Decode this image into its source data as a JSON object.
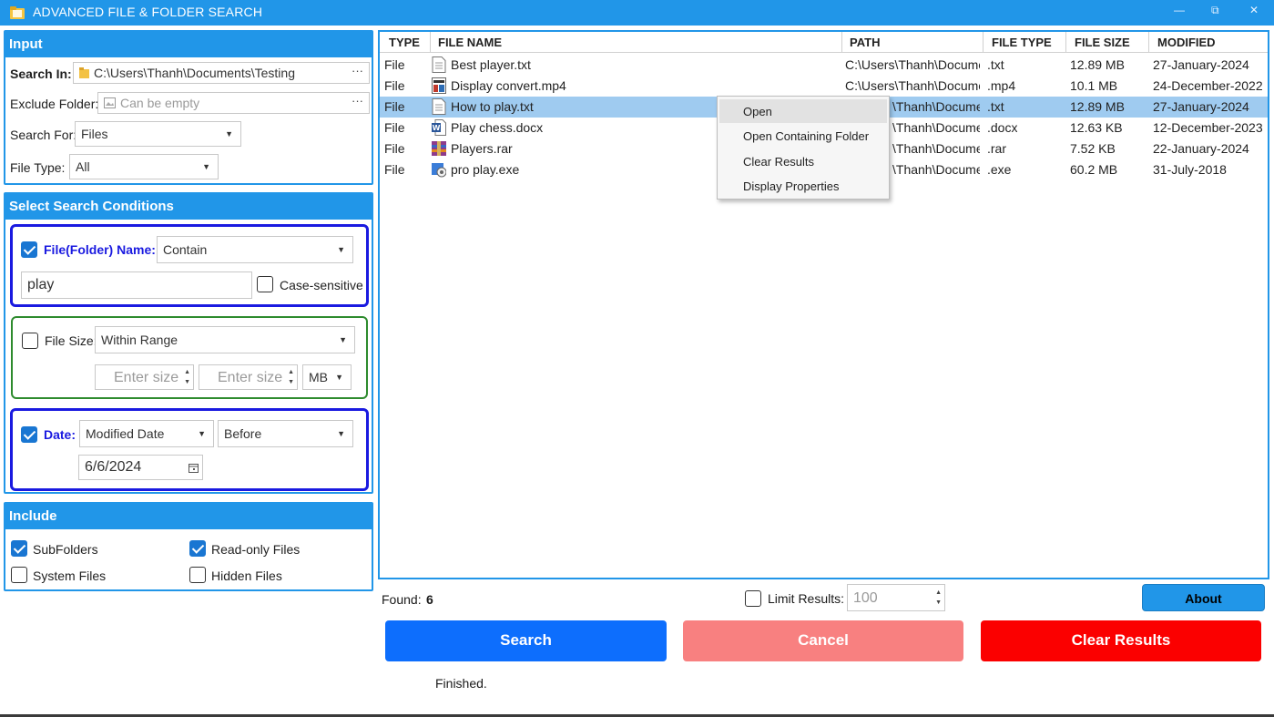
{
  "window": {
    "title": "ADVANCED FILE & FOLDER SEARCH",
    "minimize_glyph": "—",
    "restore_glyph": "⧉",
    "close_glyph": "✕",
    "icon": "folder-app-icon"
  },
  "input_panel": {
    "header": "Input",
    "search_in_label": "Search In:",
    "search_in_value": "C:\\Users\\Thanh\\Documents\\Testing",
    "browse_dots": "···",
    "exclude_label": "Exclude Folder:",
    "exclude_placeholder": "Can be empty",
    "search_for_label": "Search For:",
    "search_for_value": "Files",
    "file_type_label": "File Type:",
    "file_type_value": "All"
  },
  "conditions": {
    "header": "Select Search Conditions",
    "name": {
      "checked": true,
      "label": "File(Folder) Name:",
      "mode": "Contain",
      "query": "play",
      "case_label": "Case-sensitive",
      "case_checked": false
    },
    "size": {
      "checked": false,
      "label": "File Size:",
      "mode": "Within Range",
      "min_placeholder": "Enter size",
      "max_placeholder": "Enter size",
      "unit": "MB"
    },
    "date": {
      "checked": true,
      "label": "Date:",
      "field": "Modified Date",
      "mode": "Before",
      "value": "6/6/2024"
    }
  },
  "include": {
    "header": "Include",
    "subfolders": {
      "label": "SubFolders",
      "checked": true
    },
    "readonly": {
      "label": "Read-only Files",
      "checked": true
    },
    "system": {
      "label": "System Files",
      "checked": false
    },
    "hidden": {
      "label": "Hidden Files",
      "checked": false
    }
  },
  "results": {
    "columns": [
      "TYPE",
      "FILE NAME",
      "PATH",
      "FILE TYPE",
      "FILE SIZE",
      "MODIFIED"
    ],
    "rows": [
      {
        "type": "File",
        "name": "Best player.txt",
        "path": "C:\\Users\\Thanh\\Docume",
        "ftype": ".txt",
        "size": "12.89 MB",
        "modified": "27-January-2024",
        "icon": "text-file-icon"
      },
      {
        "type": "File",
        "name": "Display convert.mp4",
        "path": "C:\\Users\\Thanh\\Docume",
        "ftype": ".mp4",
        "size": "10.1 MB",
        "modified": "24-December-2022",
        "icon": "video-file-icon"
      },
      {
        "type": "File",
        "name": "How to play.txt",
        "path": "\\Thanh\\Docume",
        "ftype": ".txt",
        "size": "12.89 MB",
        "modified": "27-January-2024",
        "icon": "text-file-icon",
        "selected": true
      },
      {
        "type": "File",
        "name": "Play chess.docx",
        "path": "\\Thanh\\Docume",
        "ftype": ".docx",
        "size": "12.63 KB",
        "modified": "12-December-2023",
        "icon": "word-file-icon"
      },
      {
        "type": "File",
        "name": "Players.rar",
        "path": "\\Thanh\\Docume",
        "ftype": ".rar",
        "size": "7.52 KB",
        "modified": "22-January-2024",
        "icon": "archive-file-icon"
      },
      {
        "type": "File",
        "name": "pro play.exe",
        "path": "\\Thanh\\Docume",
        "ftype": ".exe",
        "size": "60.2 MB",
        "modified": "31-July-2018",
        "icon": "exe-file-icon"
      }
    ]
  },
  "context_menu": {
    "items": [
      "Open",
      "Open Containing Folder",
      "Clear Results",
      "Display Properties"
    ],
    "hovered": "Open"
  },
  "footer": {
    "found_label": "Found:",
    "found_count": "6",
    "limit_label": "Limit Results:",
    "limit_checked": false,
    "limit_value": "100",
    "about_label": "About",
    "search_label": "Search",
    "cancel_label": "Cancel",
    "clear_label": "Clear Results",
    "status": "Finished."
  },
  "colors": {
    "accent": "#2196e8",
    "search_button": "#0d6efd",
    "cancel_button": "#f88080",
    "clear_button": "#fb0000",
    "selected_row": "#9fcbf0",
    "name_condition_border": "#1a1ae0",
    "size_condition_border": "#2e8b2e"
  }
}
